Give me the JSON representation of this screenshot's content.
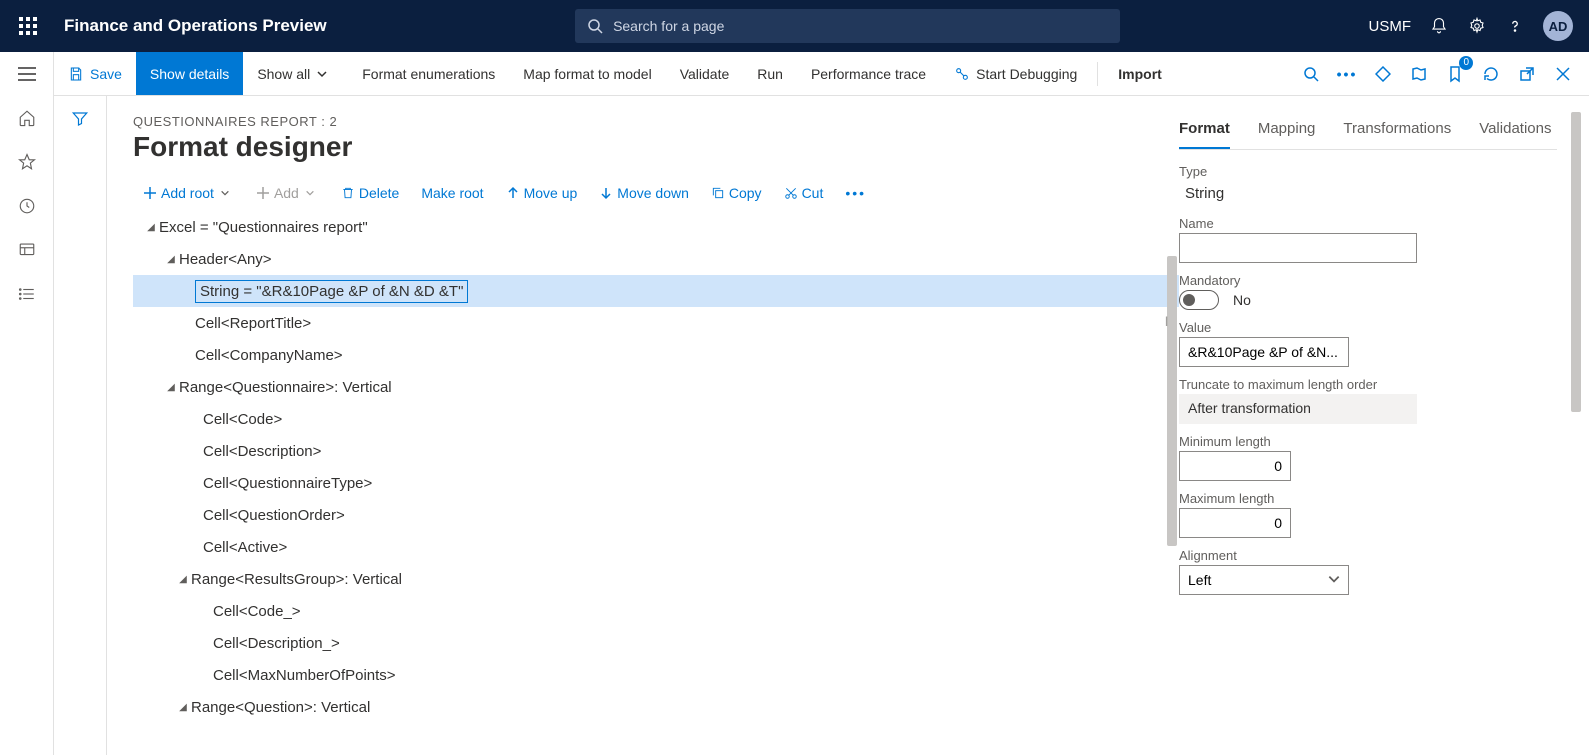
{
  "header": {
    "app_title": "Finance and Operations Preview",
    "search_placeholder": "Search for a page",
    "company": "USMF",
    "avatar": "AD"
  },
  "action_bar": {
    "save": "Save",
    "show_details": "Show details",
    "show_all": "Show all",
    "format_enum": "Format enumerations",
    "map_format": "Map format to model",
    "validate": "Validate",
    "run": "Run",
    "perf": "Performance trace",
    "debug": "Start Debugging",
    "import": "Import",
    "badge": "0"
  },
  "page": {
    "breadcrumb": "QUESTIONNAIRES REPORT : 2",
    "title": "Format designer"
  },
  "tree_toolbar": {
    "add_root": "Add root",
    "add": "Add",
    "delete": "Delete",
    "make_root": "Make root",
    "move_up": "Move up",
    "move_down": "Move down",
    "copy": "Copy",
    "cut": "Cut"
  },
  "tree": {
    "n0": "Excel = \"Questionnaires report\"",
    "n1": "Header<Any>",
    "n2": "String = \"&R&10Page &P of &N &D &T\"",
    "n3": "Cell<ReportTitle>",
    "n4": "Cell<CompanyName>",
    "n5": "Range<Questionnaire>: Vertical",
    "n6": "Cell<Code>",
    "n7": "Cell<Description>",
    "n8": "Cell<QuestionnaireType>",
    "n9": "Cell<QuestionOrder>",
    "n10": "Cell<Active>",
    "n11": "Range<ResultsGroup>: Vertical",
    "n12": "Cell<Code_>",
    "n13": "Cell<Description_>",
    "n14": "Cell<MaxNumberOfPoints>",
    "n15": "Range<Question>: Vertical"
  },
  "tabs": {
    "format": "Format",
    "mapping": "Mapping",
    "transformations": "Transformations",
    "validations": "Validations"
  },
  "form": {
    "type_label": "Type",
    "type_value": "String",
    "name_label": "Name",
    "name_value": "",
    "mandatory_label": "Mandatory",
    "mandatory_text": "No",
    "value_label": "Value",
    "value_value": "&R&10Page &P of &N...",
    "truncate_label": "Truncate to maximum length order",
    "truncate_value": "After transformation",
    "min_label": "Minimum length",
    "min_value": "0",
    "max_label": "Maximum length",
    "max_value": "0",
    "align_label": "Alignment",
    "align_value": "Left"
  }
}
